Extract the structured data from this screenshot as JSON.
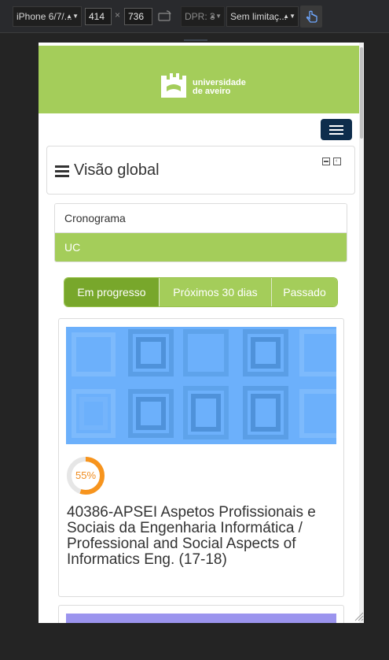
{
  "devtools": {
    "device": "iPhone 6/7/...",
    "width": "414",
    "times": "×",
    "height": "736",
    "dpr": "DPR: 3",
    "throttle": "Sem limitaç..."
  },
  "header": {
    "logo_line1": "universidade",
    "logo_line2": "de aveiro"
  },
  "block": {
    "title": "Visão global"
  },
  "tabs": [
    {
      "label": "Cronograma"
    },
    {
      "label": "UC"
    }
  ],
  "filters": [
    {
      "label": "Em progresso"
    },
    {
      "label": "Próximos 30 dias"
    },
    {
      "label": "Passado"
    }
  ],
  "course": {
    "progress": "55%",
    "progress_value": 0.55,
    "title": "40386-APSEI Aspetos Profissionais e Sociais da Engenharia Informática / Professional and Social Aspects of Informatics Eng. (17-18)"
  },
  "colors": {
    "brand_green": "#a4cd5a",
    "active_green": "#78a72b",
    "navy": "#0e2d4c",
    "progress_orange": "#f7941d",
    "card_blue": "#6cb0fb"
  }
}
